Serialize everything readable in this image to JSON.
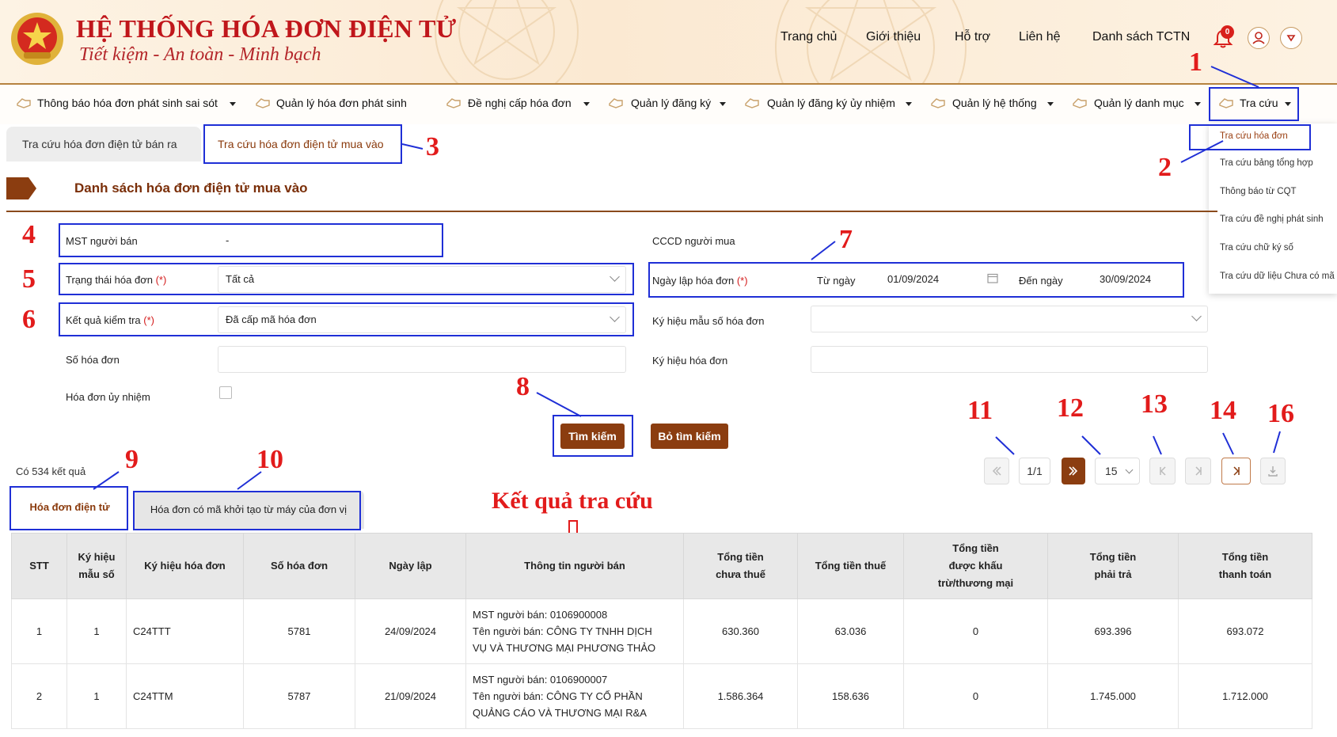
{
  "header": {
    "title": "HỆ THỐNG HÓA ĐƠN ĐIỆN TỬ",
    "slogan": "Tiết kiệm - An toàn - Minh bạch",
    "nav": [
      "Trang chủ",
      "Giới thiệu",
      "Hỗ trợ",
      "Liên hệ",
      "Danh sách TCTN"
    ],
    "notification_count": "0"
  },
  "menu": [
    "Thông báo hóa đơn phát sinh sai sót",
    "Quản lý hóa đơn phát sinh",
    "Đề nghị cấp hóa đơn",
    "Quản lý đăng ký",
    "Quản lý đăng ký ủy nhiệm",
    "Quản lý hệ thống",
    "Quản lý danh mục",
    "Tra cứu"
  ],
  "dropdown": [
    "Tra cứu hóa đơn",
    "Tra cứu bảng tổng hợp",
    "Thông báo từ CQT",
    "Tra cứu đề nghị phát sinh",
    "Tra cứu chữ ký số",
    "Tra cứu dữ liệu Chưa có mã"
  ],
  "tabs": [
    "Tra cứu hóa đơn điện tử bán ra",
    "Tra cứu hóa đơn điện tử mua vào"
  ],
  "section_title": "Danh sách hóa đơn điện tử mua vào",
  "form": {
    "mst_label": "MST người bán",
    "mst_value": "-",
    "status_label": "Trạng thái hóa đơn",
    "status_value": "Tất cả",
    "check_label": "Kết quả kiểm tra",
    "check_value": "Đã cấp mã hóa đơn",
    "number_label": "Số hóa đơn",
    "delegated_label": "Hóa đơn ủy nhiệm",
    "cccd_label": "CCCD người mua",
    "date_label": "Ngày lập hóa đơn",
    "from_label": "Từ ngày",
    "from_value": "01/09/2024",
    "to_label": "Đến ngày",
    "to_value": "30/09/2024",
    "template_label": "Ký hiệu mẫu số hóa đơn",
    "symbol_label": "Ký hiệu hóa đơn",
    "required": "(*)",
    "search_button": "Tìm kiếm",
    "clear_button": "Bỏ tìm kiếm"
  },
  "pagination": {
    "page": "1/1",
    "page_size": "15"
  },
  "result_count": "Có 534 kết quả",
  "result_tabs": [
    "Hóa đơn điện tử",
    "Hóa đơn có mã khởi tạo từ máy của đơn vị"
  ],
  "result_caption": "Kết quả tra cứu",
  "annotations": [
    "1",
    "2",
    "3",
    "4",
    "5",
    "6",
    "7",
    "8",
    "9",
    "10",
    "11",
    "12",
    "13",
    "14",
    "16"
  ],
  "colors": {
    "accent": "#8b3d10",
    "annotation_box": "#1f2fd6",
    "annotation_number": "#e21b1b",
    "brand_red": "#c0161b"
  },
  "table": {
    "headers": [
      "STT",
      "Ký hiệu\nmẫu số",
      "Ký hiệu hóa đơn",
      "Số hóa đơn",
      "Ngày lập",
      "Thông tin người bán",
      "Tổng tiền\nchưa thuế",
      "Tổng tiền thuế",
      "Tổng tiền\nđược khấu\ntrừ/thương mại",
      "Tổng tiền\nphải trả",
      "Tổng tiền\nthanh toán"
    ],
    "rows": [
      [
        "1",
        "1",
        "C24TTT",
        "5781",
        "24/09/2024",
        "MST người bán: 0106900008\nTên người bán: CÔNG TY TNHH DỊCH\nVỤ VÀ THƯƠNG MẠI PHƯƠNG THẢO",
        "630.360",
        "63.036",
        "0",
        "693.396",
        "693.072"
      ],
      [
        "2",
        "1",
        "C24TTM",
        "5787",
        "21/09/2024",
        "MST người bán: 0106900007\nTên người bán: CÔNG TY CỔ PHẦN\nQUẢNG CÁO VÀ THƯƠNG MẠI R&A",
        "1.586.364",
        "158.636",
        "0",
        "1.745.000",
        "1.712.000"
      ]
    ]
  }
}
